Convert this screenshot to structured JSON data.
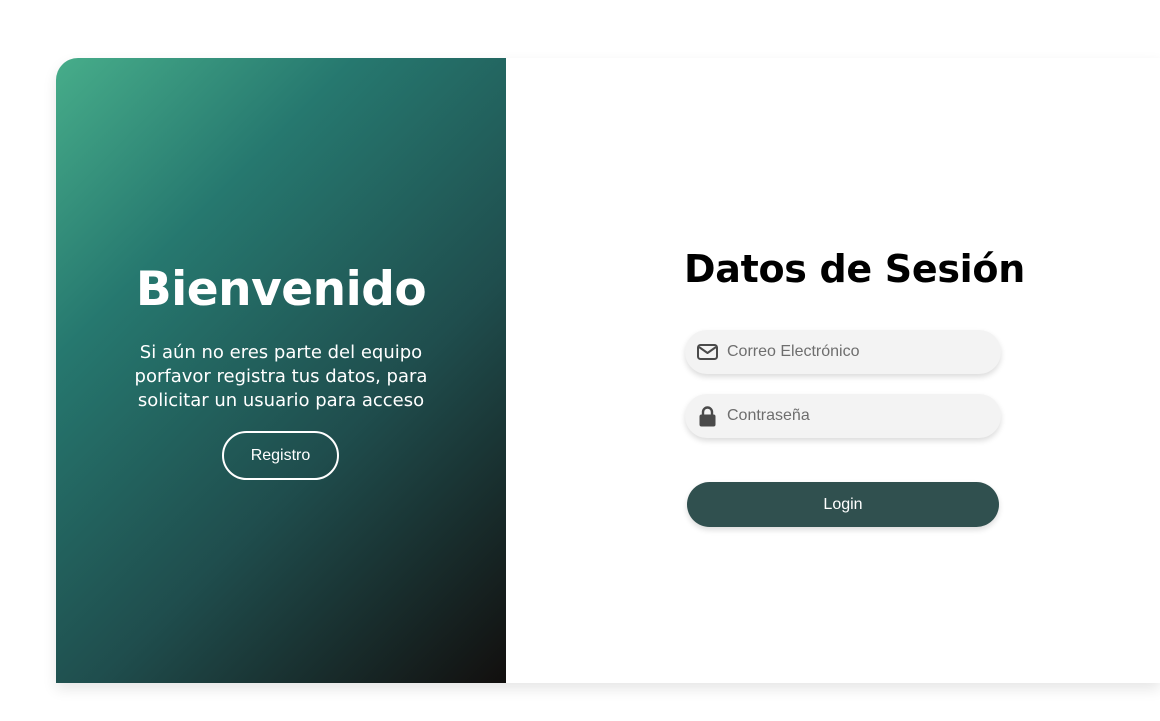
{
  "welcome": {
    "title": "Bienvenido",
    "message_line1": "Si aún no eres parte del equipo",
    "message_line2": "porfavor registra tus datos, para",
    "message_line3": "solicitar un usuario para acceso",
    "register_label": "Registro"
  },
  "login": {
    "title": "Datos de Sesión",
    "email": {
      "placeholder": "Correo Electrónico",
      "value": "",
      "icon": "envelope-icon"
    },
    "password": {
      "placeholder": "Contraseña",
      "value": "",
      "icon": "lock-icon"
    },
    "submit_label": "Login"
  },
  "colors": {
    "gradient_start": "#47ad8a",
    "gradient_end": "#120f0e",
    "login_button": "#30504f",
    "input_background": "#f3f3f3"
  }
}
